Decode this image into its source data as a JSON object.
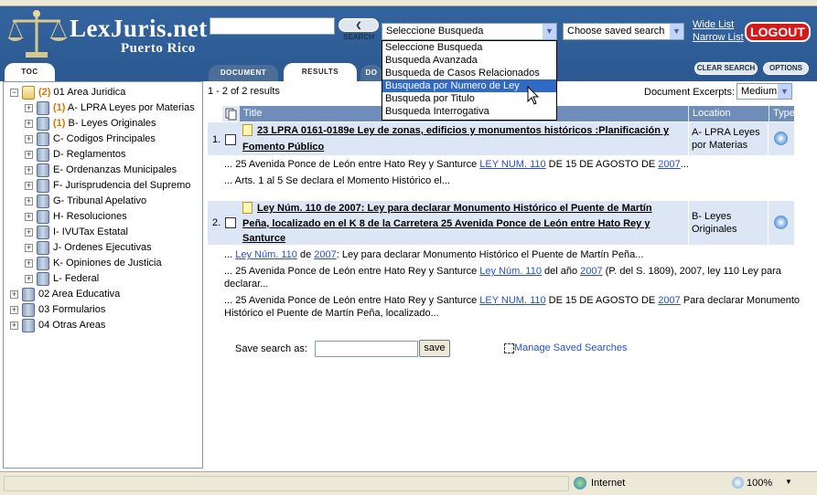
{
  "header": {
    "logo_title": "LexJuris.net",
    "logo_subtitle": "Puerto Rico",
    "search_button": "SEARCH",
    "search_value": "",
    "search_type_selected": "Seleccione Busqueda",
    "saved_search_selected": "Choose saved search",
    "wide_list": "Wide List",
    "narrow_list": "Narrow List",
    "logout": "LOGOUT"
  },
  "search_type_options": [
    "Seleccione Busqueda",
    "Busqueda Avanzada",
    "Busqueda de Casos Relacionados",
    "Busqueda por Numero de Ley",
    "Busqueda por Titulo",
    "Busqueda Interrogativa"
  ],
  "highlighted_option": "Busqueda por Numero de Ley",
  "tabs": {
    "toc": "TOC",
    "document": "DOCUMENT",
    "results": "RESULTS",
    "partial": "DO"
  },
  "toolbar": {
    "clear_search": "CLEAR SEARCH",
    "options": "OPTIONS"
  },
  "tree": {
    "root": {
      "count": "(2)",
      "label": "01 Area Juridica"
    },
    "children": [
      {
        "count": "(1)",
        "label": "A- LPRA Leyes por Materias"
      },
      {
        "count": "(1)",
        "label": "B- Leyes Originales"
      },
      {
        "count": "",
        "label": "C- Codigos Principales"
      },
      {
        "count": "",
        "label": "D- Reglamentos"
      },
      {
        "count": "",
        "label": "E- Ordenanzas Municipales"
      },
      {
        "count": "",
        "label": "F- Jurisprudencia del Supremo"
      },
      {
        "count": "",
        "label": "G- Tribunal Apelativo"
      },
      {
        "count": "",
        "label": "H- Resoluciones"
      },
      {
        "count": "",
        "label": "I- IVUTax Estatal"
      },
      {
        "count": "",
        "label": "J- Ordenes Ejecutivas"
      },
      {
        "count": "",
        "label": "K- Opiniones de Justicia"
      },
      {
        "count": "",
        "label": "L- Federal"
      }
    ],
    "others": [
      {
        "label": "02 Area Educativa"
      },
      {
        "label": "03 Formularios"
      },
      {
        "label": "04 Otras Areas"
      }
    ]
  },
  "results": {
    "summary": "1 - 2 of 2 results",
    "excerpts_label": "Document Excerpts:",
    "excerpts_value": "Medium",
    "columns": {
      "title": "Title",
      "location": "Location",
      "type": "Type"
    },
    "items": [
      {
        "num": "1.",
        "title_l1": "23 LPRA 0161-0189e Ley de zonas, edificios y monumentos históricos :Planificación y",
        "title_l2": "Fomento Público",
        "location_l1": "A- LPRA Leyes",
        "location_l2": "por Materias",
        "s1_a": "... 25 Avenida Ponce de León entre Hato Rey y Santurce ",
        "s1_link1": "LEY NUM. 110",
        "s1_b": " DE 15 DE AGOSTO DE ",
        "s1_link2": "2007",
        "s1_c": "...",
        "s2": "... Arts. 1 al 5 Se declara el Momento Histórico el..."
      },
      {
        "num": "2.",
        "title_l1": "Ley Núm. 110 de 2007: Ley para declarar Monumento Histórico el Puente de Martín",
        "title_l2": "Peña, localizado en el K 8 de la Carretera 25 Avenida Ponce de León entre Hato Rey y",
        "title_l3": "Santurce",
        "location_l1": "B- Leyes",
        "location_l2": "Originales",
        "s1_a": "... ",
        "s1_link1": "Ley Núm. 110",
        "s1_b": " de ",
        "s1_link2": "2007",
        "s1_c": ": Ley para declarar Monumento Histórico el Puente de Martín Peña...",
        "s2_a": "... 25 Avenida Ponce de León entre Hato Rey y Santurce ",
        "s2_link1": "Ley Núm. 110",
        "s2_b": " del año ",
        "s2_link2": "2007",
        "s2_c": " (P. del S. 1809), 2007, ley 110   Ley para",
        "s2_d": "declarar...",
        "s3_a": "... 25 Avenida Ponce de León entre Hato Rey y Santurce ",
        "s3_link1": "LEY NUM. 110",
        "s3_b": " DE 15 DE AGOSTO DE ",
        "s3_link2": "2007",
        "s3_c": "   Para declarar Monumento",
        "s3_d": "Histórico el Puente de Martín Peña, localizado..."
      }
    ],
    "save_label": "Save search as:",
    "save_value": "",
    "save_button": "save",
    "manage": "Manage Saved Searches"
  },
  "status": {
    "zone": "Internet",
    "zoom": "100%"
  }
}
